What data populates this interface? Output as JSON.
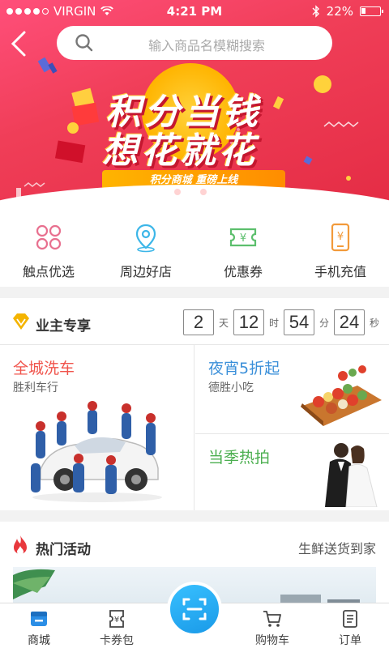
{
  "status_bar": {
    "carrier": "VIRGIN",
    "time": "4:21 PM",
    "battery": "22%"
  },
  "search": {
    "placeholder": "输入商品名模糊搜索"
  },
  "banner": {
    "line1": "积分当钱",
    "line2": "想花就花",
    "ribbon": "积分商城 重磅上线"
  },
  "categories": [
    {
      "label": "触点优选",
      "icon": "clover-icon",
      "color": "#e8708f"
    },
    {
      "label": "周边好店",
      "icon": "location-pin-icon",
      "color": "#3cb6e8"
    },
    {
      "label": "优惠券",
      "icon": "coupon-icon",
      "color": "#5cbf6d"
    },
    {
      "label": "手机充值",
      "icon": "phone-recharge-icon",
      "color": "#f29a3a"
    }
  ],
  "exclusive": {
    "title": "业主专享",
    "countdown": {
      "days": "2",
      "days_unit": "天",
      "hours": "12",
      "hours_unit": "时",
      "minutes": "54",
      "minutes_unit": "分",
      "seconds": "24",
      "seconds_unit": "秒"
    },
    "cards": [
      {
        "title": "全城洗车",
        "subtitle": "胜利车行"
      },
      {
        "title": "夜宵5折起",
        "subtitle": "德胜小吃"
      },
      {
        "title": "当季热拍",
        "subtitle": ""
      }
    ]
  },
  "hot": {
    "title": "热门活动",
    "more": "生鲜送货到家"
  },
  "tabbar": [
    {
      "label": "商城",
      "icon": "mall-icon"
    },
    {
      "label": "卡券包",
      "icon": "card-voucher-icon"
    },
    {
      "label": "",
      "icon": "scan-icon"
    },
    {
      "label": "购物车",
      "icon": "cart-icon"
    },
    {
      "label": "订单",
      "icon": "order-icon"
    }
  ],
  "colors": {
    "accent_red": "#f03e58",
    "accent_blue": "#1a9ae8",
    "gold": "#ffb400"
  }
}
